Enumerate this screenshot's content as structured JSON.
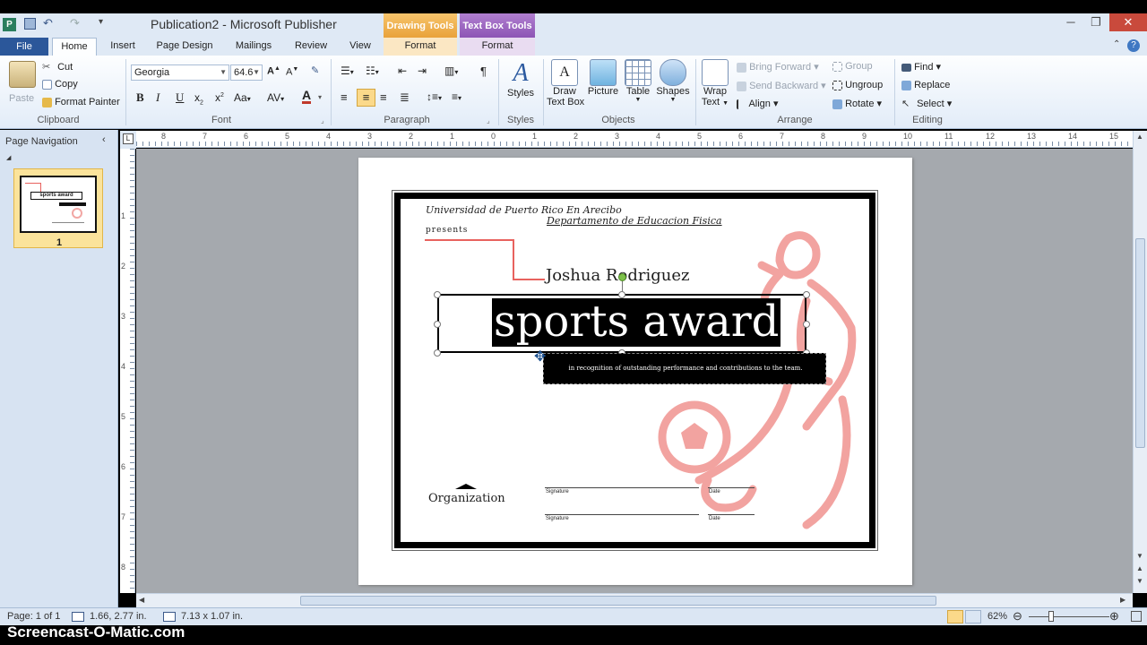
{
  "app": {
    "title": "Publication2 - Microsoft Publisher",
    "context_groups": [
      {
        "label": "Drawing Tools",
        "tab": "Format"
      },
      {
        "label": "Text Box Tools",
        "tab": "Format"
      }
    ]
  },
  "tabs": [
    "File",
    "Home",
    "Insert",
    "Page Design",
    "Mailings",
    "Review",
    "View"
  ],
  "ribbon": {
    "clipboard": {
      "label": "Clipboard",
      "paste": "Paste",
      "cut": "Cut",
      "copy": "Copy",
      "format_painter": "Format Painter"
    },
    "font": {
      "label": "Font",
      "family": "Georgia",
      "size": "64.6"
    },
    "paragraph": {
      "label": "Paragraph"
    },
    "styles": {
      "label": "Styles",
      "button": "Styles"
    },
    "objects": {
      "label": "Objects",
      "draw_text_box_1": "Draw",
      "draw_text_box_2": "Text Box",
      "picture": "Picture",
      "table": "Table",
      "shapes": "Shapes"
    },
    "arrange": {
      "label": "Arrange",
      "wrap_1": "Wrap",
      "wrap_2": "Text",
      "bring_forward": "Bring Forward",
      "send_backward": "Send Backward",
      "align": "Align",
      "group": "Group",
      "ungroup": "Ungroup",
      "rotate": "Rotate"
    },
    "editing": {
      "label": "Editing",
      "find": "Find",
      "replace": "Replace",
      "select": "Select"
    }
  },
  "nav": {
    "title": "Page Navigation",
    "page_number": "1",
    "thumb_title": "sports award"
  },
  "ruler": {
    "h_labels": [
      "8",
      "7",
      "6",
      "5",
      "4",
      "3",
      "2",
      "1",
      "0",
      "1",
      "2",
      "3",
      "4",
      "5",
      "6",
      "7",
      "8",
      "9",
      "10",
      "11",
      "12",
      "13",
      "14",
      "15"
    ],
    "v_labels": [
      "1",
      "2",
      "3",
      "4",
      "5",
      "6",
      "7",
      "8"
    ]
  },
  "certificate": {
    "university": "Universidad de Puerto Rico En Arecibo",
    "department": "Departamento de Educacion Fisica",
    "presents": "presents",
    "name": "Joshua Rodriguez",
    "title": "sports award",
    "subtitle": "in recognition of outstanding performance and contributions to the team.",
    "organization": "Organization",
    "signature_label": "Signature",
    "date_label": "Date"
  },
  "status": {
    "page": "Page: 1 of 1",
    "position": "1.66, 2.77 in.",
    "size": "7.13 x 1.07 in.",
    "zoom": "62%"
  },
  "watermark": "Screencast-O-Matic.com",
  "colors": {
    "accent_red": "#e8625e",
    "ribbon_blue": "#2b579a",
    "drawing_tools": "#f0a52c",
    "textbox_tools": "#9b59b6"
  }
}
